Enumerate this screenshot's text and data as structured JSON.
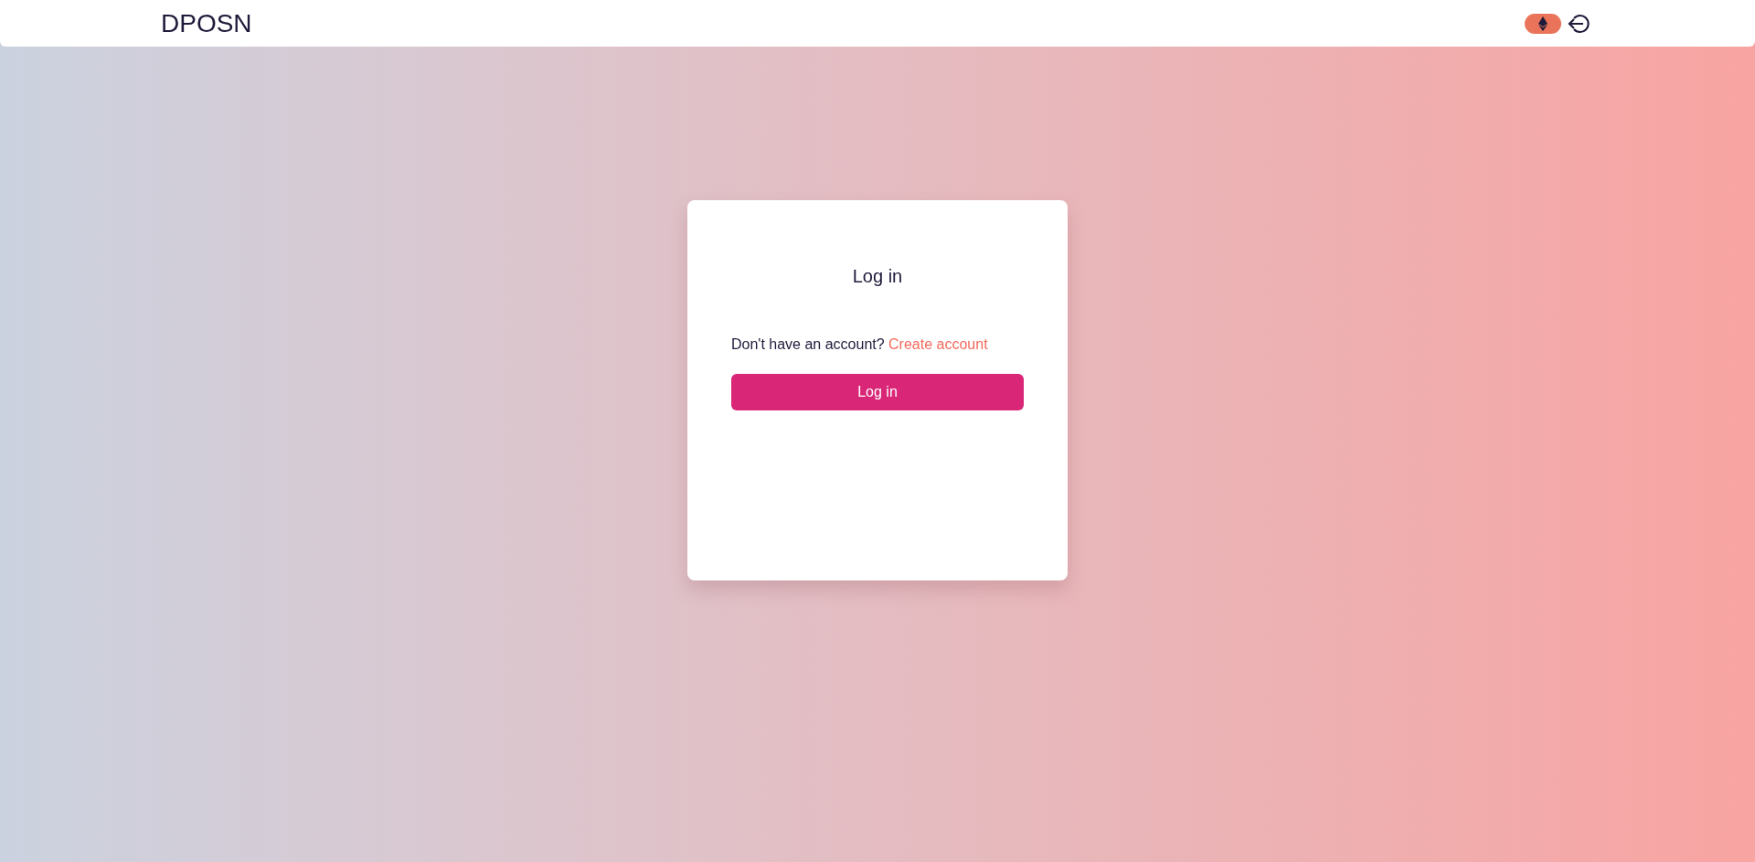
{
  "header": {
    "logo": "DPOSN"
  },
  "login_card": {
    "title": "Log in",
    "prompt": "Don't have an account?",
    "link": "Create account",
    "button": "Log in"
  }
}
